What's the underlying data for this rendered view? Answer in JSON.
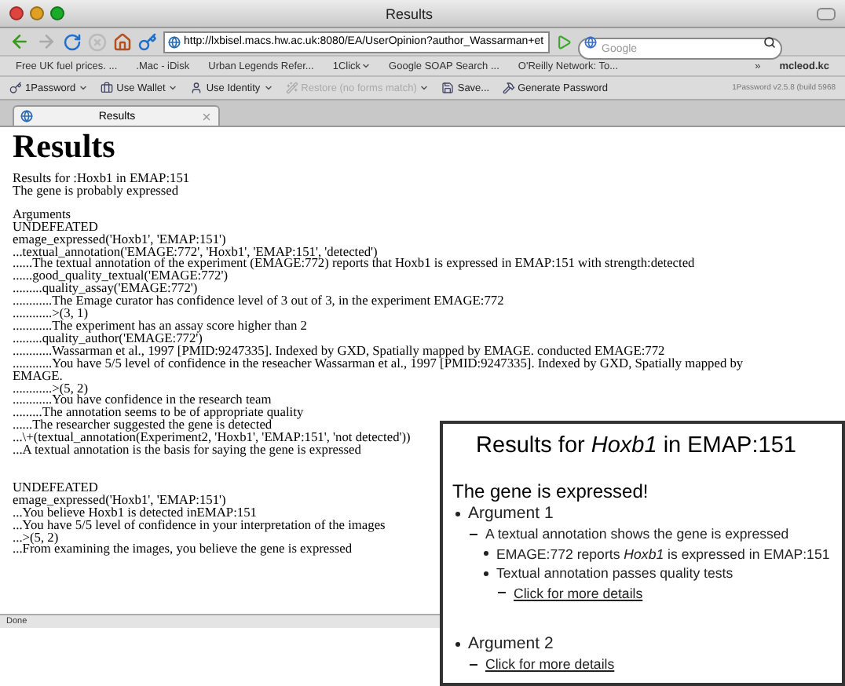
{
  "window": {
    "title": "Results"
  },
  "toolbar": {
    "url": "http://lxbisel.macs.hw.ac.uk:8080/EA/UserOpinion?author_Wassarman+et",
    "search": {
      "placeholder": "Google"
    }
  },
  "bookmarks": [
    {
      "label": "Free UK fuel prices. ...",
      "menu": false
    },
    {
      "label": ".Mac - iDisk",
      "menu": false
    },
    {
      "label": "Urban Legends Refer...",
      "menu": false
    },
    {
      "label": "1Click",
      "menu": true
    },
    {
      "label": "Google SOAP Search ...",
      "menu": false
    },
    {
      "label": "O'Reilly Network: To...",
      "menu": false
    }
  ],
  "bookmarks_more": "»",
  "bookmarks_end": "mcleod.kc",
  "password_bar": {
    "items": [
      {
        "label": "1Password",
        "menu": true,
        "disabled": false
      },
      {
        "label": "Use Wallet",
        "menu": true,
        "disabled": false
      },
      {
        "label": "Use Identity",
        "menu": true,
        "disabled": false
      },
      {
        "label": "Restore (no forms match)",
        "menu": true,
        "disabled": true
      },
      {
        "label": "Save...",
        "menu": false,
        "disabled": false
      },
      {
        "label": "Generate Password",
        "menu": false,
        "disabled": false
      }
    ],
    "version": "1Password v2.5.8 (build 5968"
  },
  "tabs": [
    {
      "label": "Results",
      "selected": true
    }
  ],
  "page": {
    "heading": "Results",
    "summary": [
      "Results for :Hoxb1 in EMAP:151",
      "The gene is probably expressed"
    ],
    "sections": [
      {
        "lines": [
          "Arguments",
          "UNDEFEATED",
          "emage_expressed('Hoxb1', 'EMAP:151')",
          "...textual_annotation('EMAGE:772', 'Hoxb1', 'EMAP:151', 'detected')",
          "......The textual annotation of the experiment (EMAGE:772) reports that Hoxb1 is expressed in EMAP:151 with strength:detected",
          "......good_quality_textual('EMAGE:772')",
          ".........quality_assay('EMAGE:772')",
          "............The Emage curator has confidence level of 3 out of 3, in the experiment EMAGE:772",
          "............>(3, 1)",
          "............The experiment has an assay score higher than 2",
          ".........quality_author('EMAGE:772')",
          "............Wassarman et al., 1997 [PMID:9247335]. Indexed by GXD, Spatially mapped by EMAGE. conducted EMAGE:772",
          "............You have 5/5 level of confidence in the reseacher Wassarman et al., 1997 [PMID:9247335]. Indexed by GXD, Spatially mapped by EMAGE.",
          "............>(5, 2)",
          "............You have confidence in the research team",
          ".........The annotation seems to be of appropriate quality",
          "......The researcher suggested the gene is detected",
          "...\\+(textual_annotation(Experiment2, 'Hoxb1', 'EMAP:151', 'not detected'))",
          "...A textual annotation is the basis for saying the gene is expressed"
        ]
      },
      {
        "lines": [
          "UNDEFEATED",
          "emage_expressed('Hoxb1', 'EMAP:151')",
          "...You believe Hoxb1 is detected inEMAP:151",
          "...You have 5/5 level of confidence in your interpretation of the images",
          "...>(5, 2)",
          "...From examining the images, you believe the gene is expressed"
        ]
      }
    ]
  },
  "status_bar": "Done",
  "overlay": {
    "title": "Results for *Hoxb1* in EMAP:151",
    "verdict": "The gene is expressed!",
    "items": [
      {
        "text": "Argument 1",
        "kind": "text",
        "children": [
          {
            "text": "A textual annotation shows the gene is expressed",
            "kind": "text",
            "children": [
              {
                "text": "EMAGE:772 reports *Hoxb1* is expressed in EMAP:151",
                "kind": "text"
              },
              {
                "text": "Textual annotation passes quality tests",
                "kind": "text",
                "children": [
                  {
                    "text": "Click for more details",
                    "kind": "link"
                  }
                ]
              }
            ]
          }
        ]
      },
      {
        "text": "Argument 2",
        "kind": "text",
        "children": [
          {
            "text": "Click for more details",
            "kind": "link"
          }
        ]
      }
    ]
  }
}
